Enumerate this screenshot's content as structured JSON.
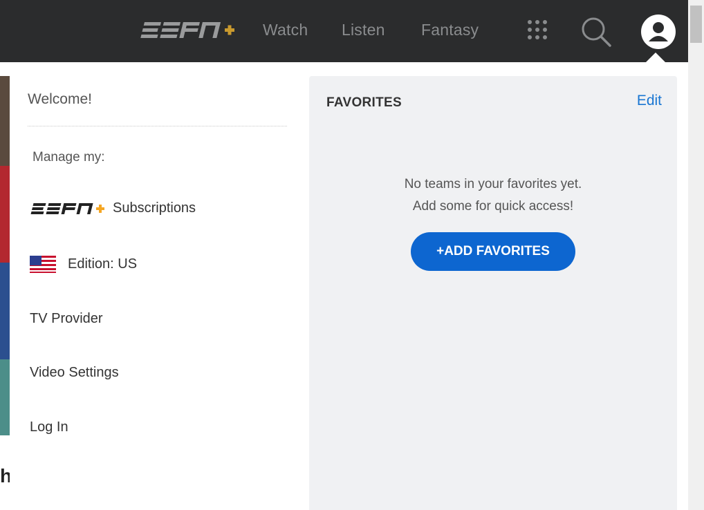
{
  "nav": {
    "brand_color": "#f5a623",
    "links": [
      "Watch",
      "Listen",
      "Fantasy"
    ],
    "icons": [
      "grid-icon",
      "search-icon",
      "profile-icon"
    ]
  },
  "menu": {
    "welcome": "Welcome!",
    "manage_label": "Manage my:",
    "subscriptions": "Subscriptions",
    "edition": "Edition: US",
    "tv_provider": "TV Provider",
    "video_settings": "Video Settings",
    "log_in": "Log In"
  },
  "favorites": {
    "title": "FAVORITES",
    "edit": "Edit",
    "empty_line1": "No teams in your favorites yet.",
    "empty_line2": "Add some for quick access!",
    "add_button": "+ADD FAVORITES",
    "accent": "#0d66d0"
  }
}
